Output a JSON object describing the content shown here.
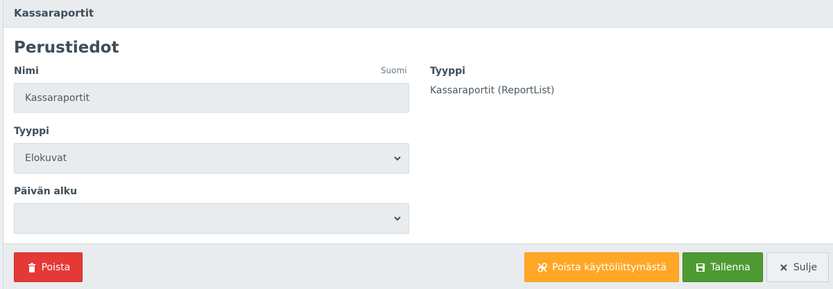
{
  "header": {
    "title": "Kassaraportit"
  },
  "section": {
    "title": "Perustiedot"
  },
  "fields": {
    "name_label": "Nimi",
    "name_lang": "Suomi",
    "name_value": "Kassaraportit",
    "type_label": "Tyyppi",
    "type_value": "Elokuvat",
    "daystart_label": "Päivän alku",
    "daystart_value": ""
  },
  "info": {
    "type_label": "Tyyppi",
    "type_value": "Kassaraportit (ReportList)"
  },
  "footer": {
    "delete_label": "Poista",
    "unlink_label": "Poista käyttöliittymästä",
    "save_label": "Tallenna",
    "close_label": "Sulje"
  },
  "colors": {
    "delete": "#e53935",
    "unlink": "#ffa726",
    "save": "#4e9a32"
  },
  "icons": {
    "delete": "trash-icon",
    "unlink": "unlink-icon",
    "save": "floppy-disk-icon",
    "close": "close-icon",
    "select": "chevron-down-icon"
  }
}
